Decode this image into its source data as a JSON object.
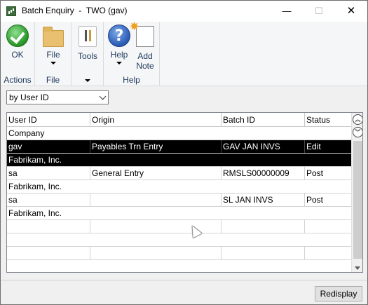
{
  "window": {
    "title": "Batch Enquiry  -  TWO (gav)",
    "min_glyph": "—",
    "max_glyph": "☐",
    "close_glyph": "✕"
  },
  "ribbon": {
    "groups": [
      {
        "label": "Actions",
        "buttons": [
          {
            "label": "OK",
            "icon": "ok-checkmark-icon"
          }
        ]
      },
      {
        "label": "File",
        "buttons": [
          {
            "label": "File",
            "icon": "folder-icon"
          }
        ]
      },
      {
        "label": "",
        "buttons": [
          {
            "label": "Tools",
            "icon": "tools-icon"
          }
        ]
      },
      {
        "label": "Help",
        "buttons": [
          {
            "label": "Help",
            "icon": "help-question-icon"
          },
          {
            "label": "Add",
            "label2": "Note",
            "icon": "add-note-icon"
          }
        ]
      }
    ]
  },
  "filter": {
    "selected": "by User ID"
  },
  "grid": {
    "columns": [
      "User ID",
      "Origin",
      "Batch ID",
      "Status"
    ],
    "sub_header": "Company",
    "rows": [
      {
        "user_id": "gav",
        "origin": "Payables Trn Entry",
        "batch_id": "GAV JAN INVS",
        "status": "Edit",
        "company": "Fabrikam, Inc.",
        "selected": true
      },
      {
        "user_id": "sa",
        "origin": "General Entry",
        "batch_id": "RMSLS00000009",
        "status": "Post",
        "company": "Fabrikam, Inc.",
        "selected": false
      },
      {
        "user_id": "sa",
        "origin": "",
        "batch_id": "SL JAN INVS",
        "status": "Post",
        "company": "Fabrikam, Inc.",
        "selected": false
      }
    ]
  },
  "footer": {
    "redisplay_label": "Redisplay"
  },
  "colors": {
    "selection": "#000000",
    "ribbon_text": "#1e395b"
  }
}
